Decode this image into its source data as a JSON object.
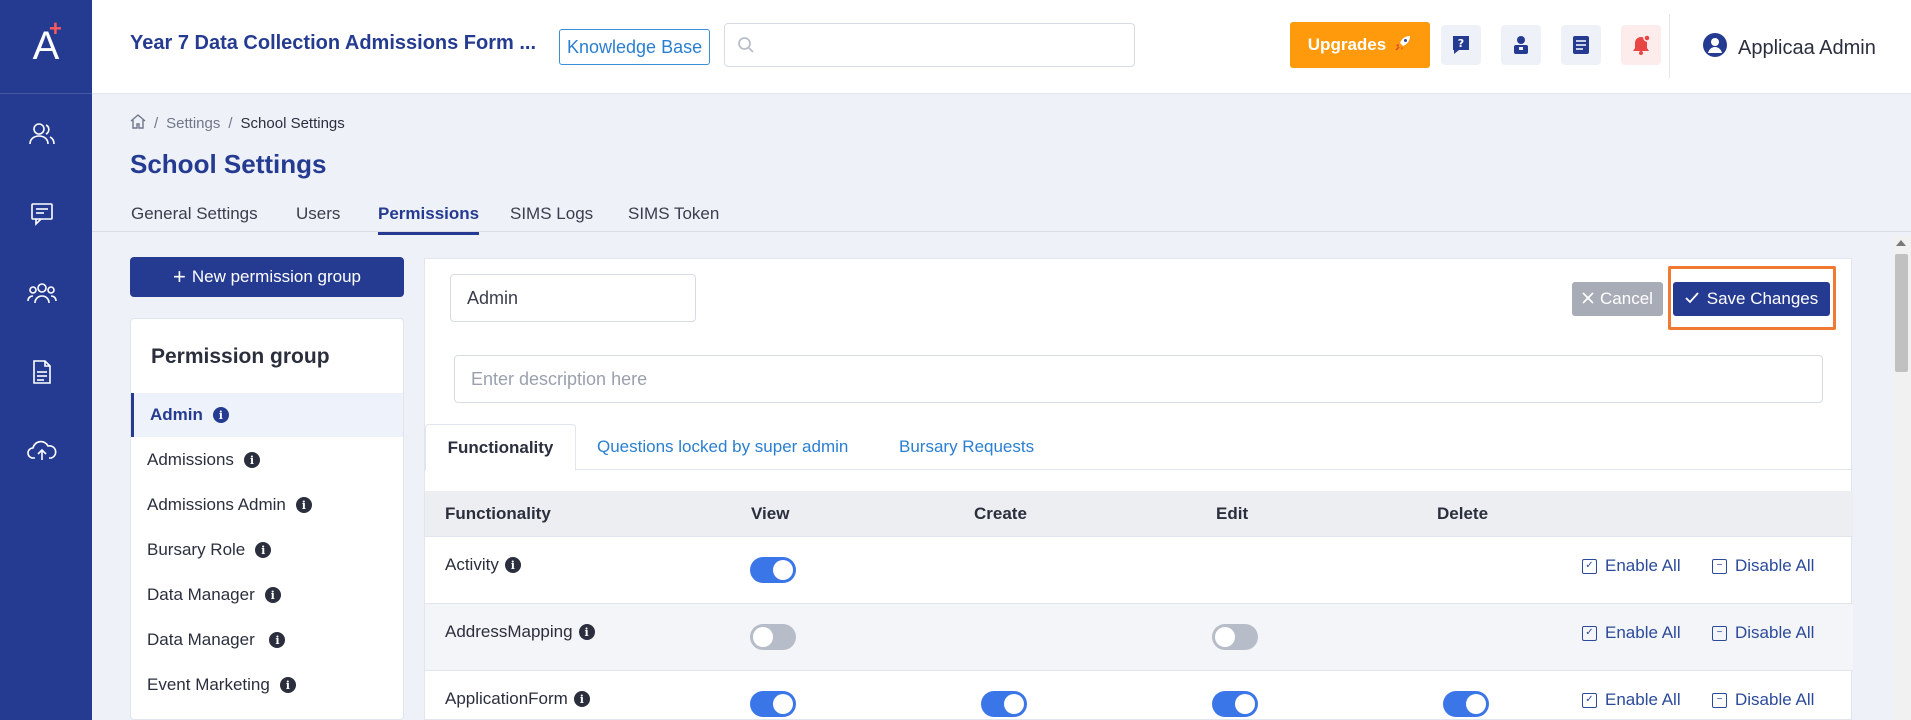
{
  "app": {
    "title": "Year 7 Data Collection Admissions Form ...",
    "knowledge_base": "Knowledge Base",
    "search_placeholder": "",
    "upgrades": "Upgrades",
    "user_name": "Applicaa Admin",
    "accent": "#253b91",
    "upgrade_color": "#ff9a0d"
  },
  "rail": {
    "icons": [
      "users-icon",
      "message-icon",
      "group-icon",
      "document-icon",
      "cloud-upload-icon"
    ]
  },
  "breadcrumb": {
    "items": [
      "Settings",
      "School Settings"
    ]
  },
  "page": {
    "title": "School Settings",
    "tabs": [
      "General Settings",
      "Users",
      "Permissions",
      "SIMS Logs",
      "SIMS Token"
    ],
    "active_tab": "Permissions"
  },
  "groups": {
    "new_button": "New permission group",
    "heading": "Permission group",
    "items": [
      "Admin",
      "Admissions",
      "Admissions Admin",
      "Bursary Role",
      "Data Manager",
      "Data Manager ",
      "Event Marketing"
    ]
  },
  "editor": {
    "name_value": "Admin",
    "cancel": "Cancel",
    "save": "Save Changes",
    "description_placeholder": "Enter description here",
    "sub_tabs": [
      "Functionality",
      "Questions locked by super admin",
      "Bursary Requests"
    ]
  },
  "table": {
    "headers": [
      "Functionality",
      "View",
      "Create",
      "Edit",
      "Delete"
    ],
    "enable_all": "Enable All",
    "disable_all": "Disable All",
    "rows": [
      {
        "name": "Activity",
        "view": true,
        "create": null,
        "edit": null,
        "delete": null
      },
      {
        "name": "AddressMapping",
        "view": false,
        "create": null,
        "edit": false,
        "delete": null
      },
      {
        "name": "ApplicationForm",
        "view": true,
        "create": true,
        "edit": true,
        "delete": true
      }
    ]
  }
}
